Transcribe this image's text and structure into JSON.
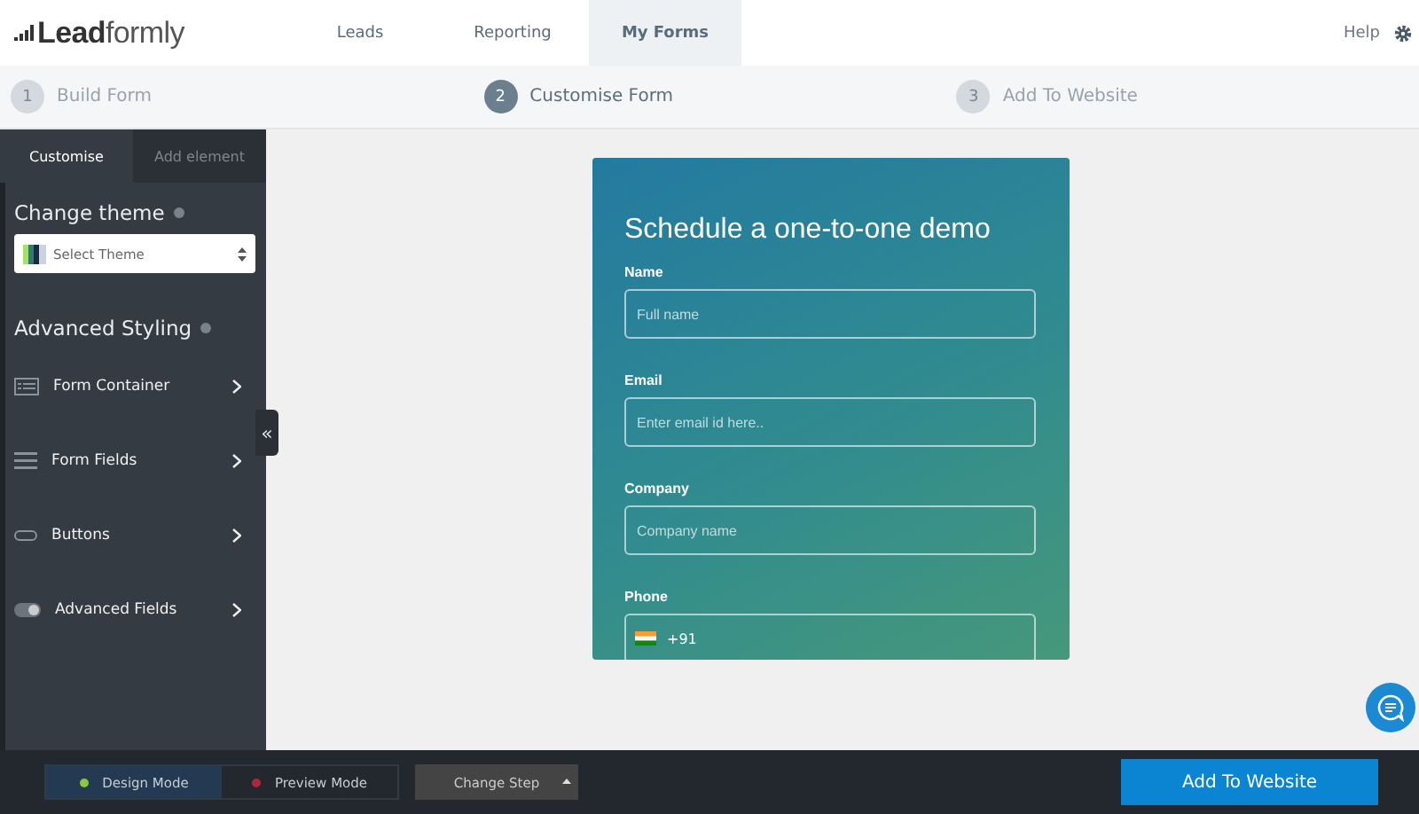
{
  "brand": {
    "name_bold": "Lead",
    "name_light": "formly"
  },
  "nav": [
    {
      "label": "Leads",
      "selected": false
    },
    {
      "label": "Reporting",
      "selected": false
    },
    {
      "label": "My Forms",
      "selected": true
    }
  ],
  "help": "Help",
  "steps": [
    {
      "number": "1",
      "label": "Build Form",
      "selected": false
    },
    {
      "number": "2",
      "label": "Customise Form",
      "selected": true
    },
    {
      "number": "3",
      "label": "Add To Website",
      "selected": false
    }
  ],
  "sidebar": {
    "tabs": [
      {
        "label": "Customise",
        "selected": true
      },
      {
        "label": "Add element",
        "selected": false
      }
    ],
    "theme_heading": "Change theme",
    "theme_select": "Select Theme",
    "styling_heading": "Advanced Styling",
    "items": [
      {
        "kind": "container",
        "label": "Form Container"
      },
      {
        "kind": "fields",
        "label": "Form Fields"
      },
      {
        "kind": "buttons",
        "label": "Buttons"
      },
      {
        "kind": "toggle",
        "label": "Advanced Fields"
      }
    ],
    "collapse": "«"
  },
  "form": {
    "title": "Schedule a one-to-one demo",
    "fields": [
      {
        "kind": "text",
        "label": "Name",
        "placeholder": "Full name"
      },
      {
        "kind": "text",
        "label": "Email",
        "placeholder": "Enter email id here.."
      },
      {
        "kind": "text",
        "label": "Company",
        "placeholder": "Company name"
      },
      {
        "kind": "phone",
        "label": "Phone",
        "value": "+91"
      }
    ]
  },
  "footer": {
    "modes": [
      {
        "label": "Design Mode",
        "selected": true,
        "color": "#8dc63f"
      },
      {
        "label": "Preview Mode",
        "selected": false,
        "color": "#b0263a"
      }
    ],
    "change_step": "Change Step",
    "add_button": "Add To Website"
  }
}
